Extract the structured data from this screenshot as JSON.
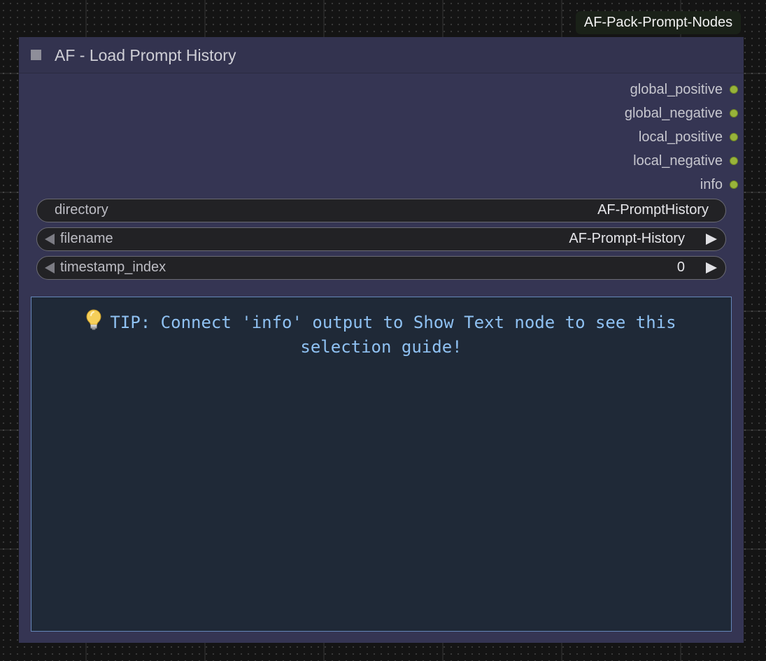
{
  "pack_badge": "AF-Pack-Prompt-Nodes",
  "node": {
    "title": "AF - Load Prompt History",
    "outputs": [
      {
        "label": "global_positive"
      },
      {
        "label": "global_negative"
      },
      {
        "label": "local_positive"
      },
      {
        "label": "local_negative"
      },
      {
        "label": "info"
      }
    ],
    "widgets": {
      "directory": {
        "label": "directory",
        "value": "AF-PromptHistory"
      },
      "filename": {
        "label": "filename",
        "value": "AF-Prompt-History"
      },
      "timestamp_index": {
        "label": "timestamp_index",
        "value": "0"
      }
    },
    "tip": {
      "icon": "lightbulb-icon",
      "line1": "TIP: Connect 'info' output to Show Text node to see this",
      "line2": "selection guide!"
    }
  },
  "colors": {
    "node_body": "#353553",
    "output_dot": "#98b43a",
    "tip_text": "#8fc1f2",
    "textarea_border": "#6688bb"
  }
}
